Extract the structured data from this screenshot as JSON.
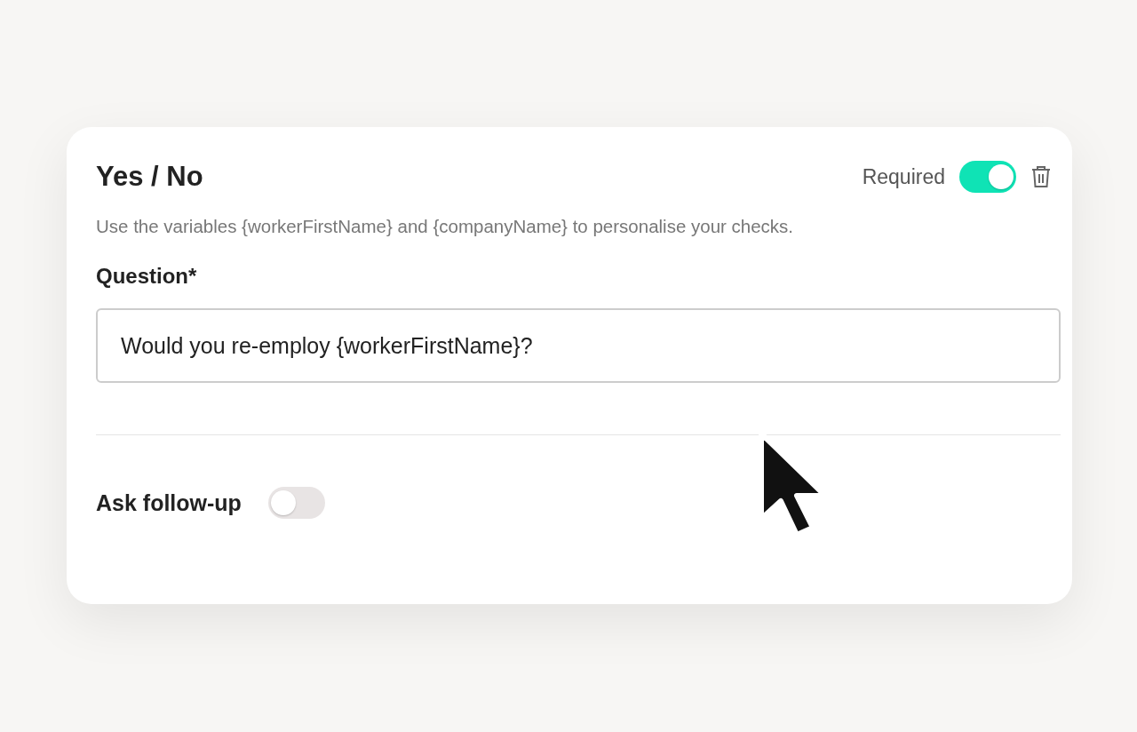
{
  "card": {
    "title": "Yes / No",
    "required": {
      "label": "Required",
      "on": true
    },
    "description": "Use the variables {workerFirstName} and {companyName} to personalise your checks.",
    "question": {
      "label": "Question*",
      "value": "Would you re-employ {workerFirstName}?"
    },
    "follow_up": {
      "label": "Ask follow-up",
      "on": false
    }
  }
}
